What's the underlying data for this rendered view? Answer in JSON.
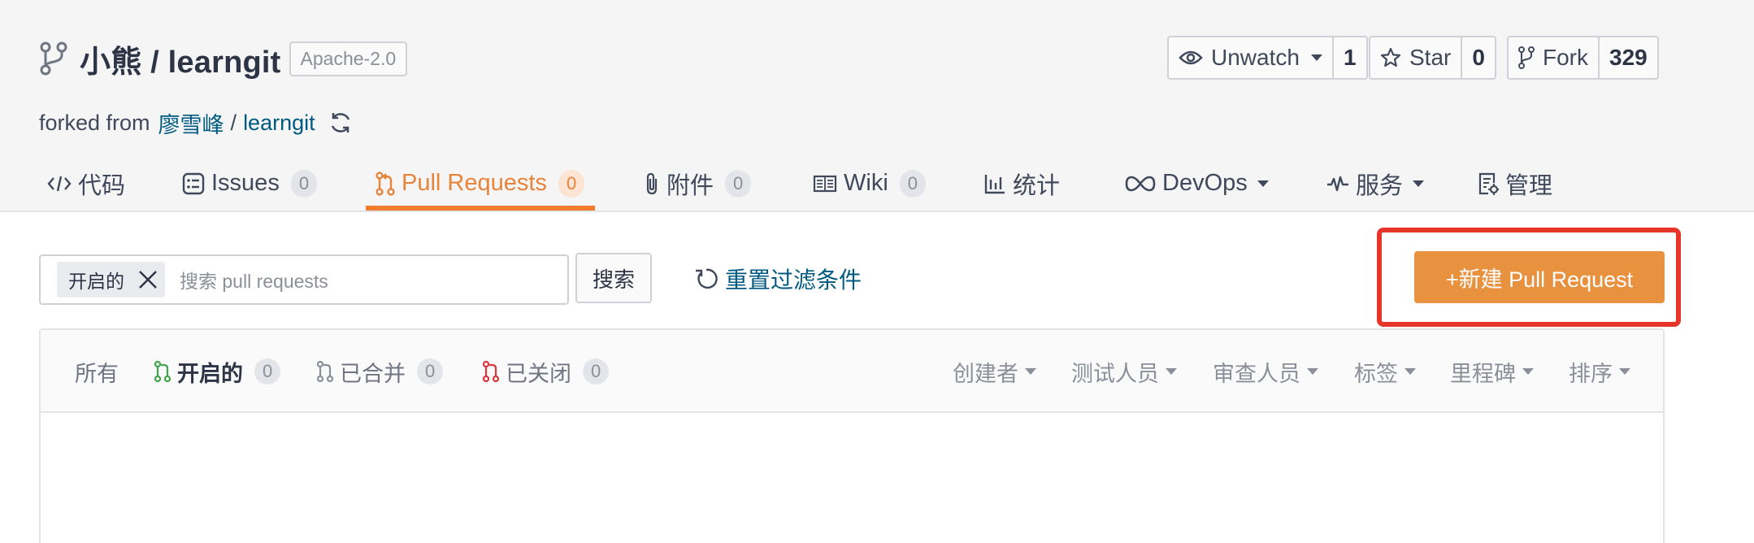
{
  "repo": {
    "owner": "小熊",
    "name": "learngit",
    "full_title": "小熊 / learngit",
    "license": "Apache-2.0",
    "forked_prefix": "forked from",
    "forked_owner": "廖雪峰",
    "forked_separator": "/",
    "forked_repo": "learngit"
  },
  "controls": {
    "watch": {
      "label": "Unwatch",
      "count": "1"
    },
    "star": {
      "label": "Star",
      "count": "0"
    },
    "fork": {
      "label": "Fork",
      "count": "329"
    }
  },
  "tabs": [
    {
      "label": "代码",
      "icon": "code-icon"
    },
    {
      "label": "Issues",
      "count": "0",
      "icon": "issues-icon"
    },
    {
      "label": "Pull Requests",
      "count": "0",
      "icon": "pull-request-icon",
      "active": true
    },
    {
      "label": "附件",
      "count": "0",
      "icon": "paperclip-icon"
    },
    {
      "label": "Wiki",
      "count": "0",
      "icon": "book-icon"
    },
    {
      "label": "统计",
      "icon": "bar-chart-icon"
    },
    {
      "label": "DevOps",
      "icon": "infinity-icon"
    },
    {
      "label": "服务",
      "icon": "pulse-icon"
    },
    {
      "label": "管理",
      "icon": "settings-doc-icon"
    }
  ],
  "filter": {
    "tag_label": "开启的",
    "search_placeholder": "搜索 pull requests",
    "search_button": "搜索",
    "reset_label": "重置过滤条件"
  },
  "new_pr_button": "+新建 Pull Request",
  "status_tabs": [
    {
      "label": "所有"
    },
    {
      "label": "开启的",
      "count": "0",
      "active": true
    },
    {
      "label": "已合并",
      "count": "0"
    },
    {
      "label": "已关闭",
      "count": "0"
    }
  ],
  "dropdowns": [
    "创建者",
    "测试人员",
    "审查人员",
    "标签",
    "里程碑",
    "排序"
  ],
  "colors": {
    "accent": "#e8833a",
    "button": "#e8913f",
    "highlight": "#e8352a",
    "link": "#005980",
    "open_green": "#3fa34d",
    "closed_red": "#d9363e"
  }
}
